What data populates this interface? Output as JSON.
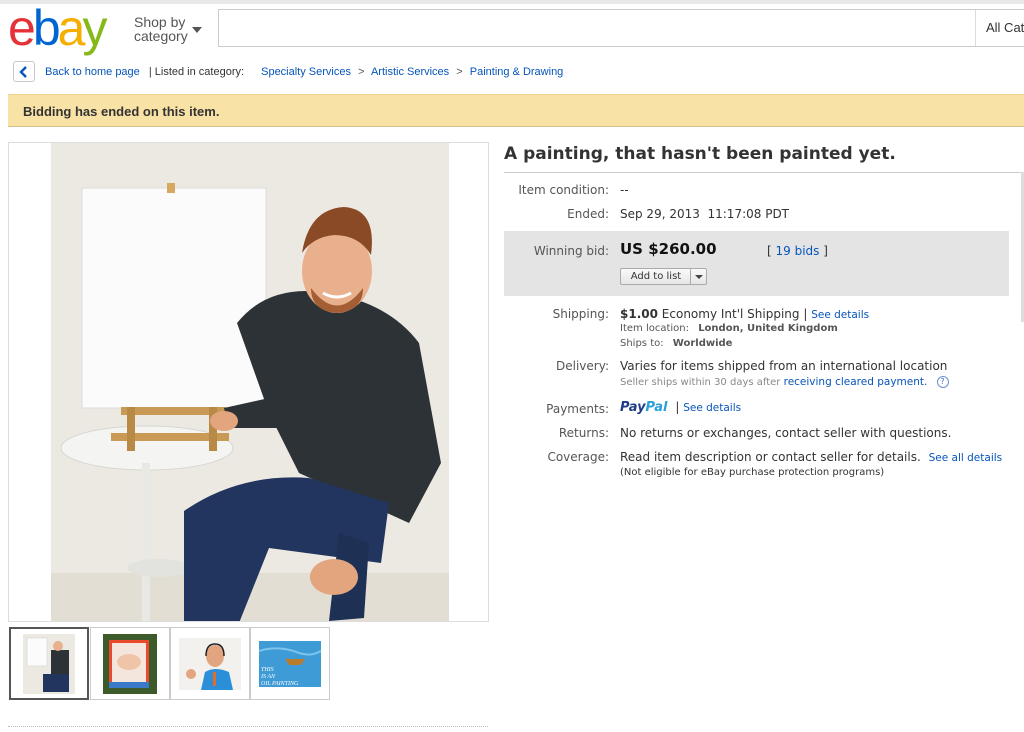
{
  "header": {
    "logo": [
      "e",
      "b",
      "a",
      "y"
    ],
    "logo_colors": [
      "#e53238",
      "#0064d2",
      "#f5af02",
      "#86b817"
    ],
    "shop_by_line1": "Shop by",
    "shop_by_line2": "category",
    "search_placeholder": "",
    "category_select": "All Cate"
  },
  "breadcrumb": {
    "back": "Back to home page",
    "listed_in": "| Listed in category:",
    "categories": [
      "Specialty Services",
      "Artistic Services",
      "Painting & Drawing"
    ],
    "separator": ">"
  },
  "banner": {
    "text": "Bidding has ended on this item."
  },
  "item": {
    "title": "A painting, that hasn't been painted yet.",
    "condition_label": "Item condition:",
    "condition_value": "--",
    "ended_label": "Ended:",
    "ended_value": "Sep 29, 2013  11:17:08 PDT",
    "winning_bid_label": "Winning bid:",
    "winning_bid_value": "US $260.00",
    "bids_open": "[",
    "bids_link": "19 bids",
    "bids_close": "]",
    "add_to_list": "Add to list",
    "shipping_label": "Shipping:",
    "shipping_price": "$1.00",
    "shipping_method": "Economy Int'l Shipping |",
    "shipping_details": "See details",
    "item_location_label": "Item location:",
    "item_location_value": "London, United Kingdom",
    "ships_to_label": "Ships to:",
    "ships_to_value": "Worldwide",
    "delivery_label": "Delivery:",
    "delivery_value": "Varies for items shipped from an international location",
    "delivery_sub": "Seller ships within 30 days after",
    "delivery_sub_link": "receiving cleared payment.",
    "help_glyph": "?",
    "payments_label": "Payments:",
    "paypal_1": "Pay",
    "paypal_2": "Pal",
    "payments_sep": "|",
    "payments_details": "See details",
    "returns_label": "Returns:",
    "returns_value": "No returns or exchanges, contact seller with questions.",
    "coverage_label": "Coverage:",
    "coverage_value": "Read item description or contact seller for details.",
    "coverage_link": "See all details",
    "coverage_sub": "(Not eligible for eBay purchase protection programs)"
  },
  "colors": {
    "link": "#0654ba",
    "banner_bg": "#f9e2a6",
    "bid_box_bg": "#e4e4e4"
  },
  "gallery": {
    "thumbnails": [
      "thumbnail-man-with-canvas",
      "thumbnail-baby-painting",
      "thumbnail-man-with-headset",
      "thumbnail-boat-painting"
    ],
    "thumb_text_lines": [
      "THIS",
      "IS AN",
      "OIL PAINTING"
    ],
    "selected_index": 0
  }
}
